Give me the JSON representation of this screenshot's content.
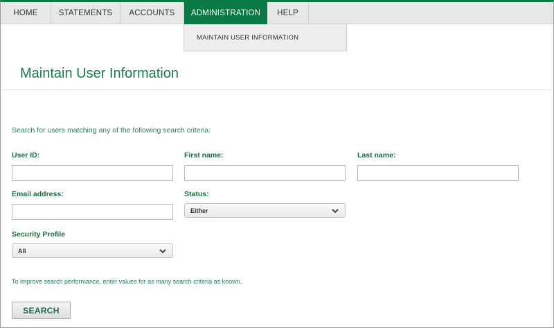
{
  "nav": {
    "items": [
      {
        "label": "HOME"
      },
      {
        "label": "STATEMENTS"
      },
      {
        "label": "ACCOUNTS"
      },
      {
        "label": "ADMINISTRATION",
        "active": true
      },
      {
        "label": "HELP"
      }
    ],
    "dropdown": {
      "items": [
        {
          "label": "MAINTAIN USER INFORMATION"
        }
      ]
    }
  },
  "page": {
    "title": "Maintain User Information",
    "intro": "Search for users matching any of the following search criteria:",
    "hint": "To improve search performance, enter values for as many search criteria as known."
  },
  "form": {
    "user_id": {
      "label": "User ID:",
      "value": ""
    },
    "first_name": {
      "label": "First name:",
      "value": ""
    },
    "last_name": {
      "label": "Last name:",
      "value": ""
    },
    "email": {
      "label": "Email address:",
      "value": ""
    },
    "status": {
      "label": "Status:",
      "selected": "Either"
    },
    "security_profile": {
      "label": "Security Profile",
      "selected": "All"
    },
    "search_label": "SEARCH"
  },
  "colors": {
    "brand_green": "#0a7a45",
    "label_green": "#1d6a42"
  },
  "icons": {
    "select_arrow": "chevron-down-icon"
  }
}
